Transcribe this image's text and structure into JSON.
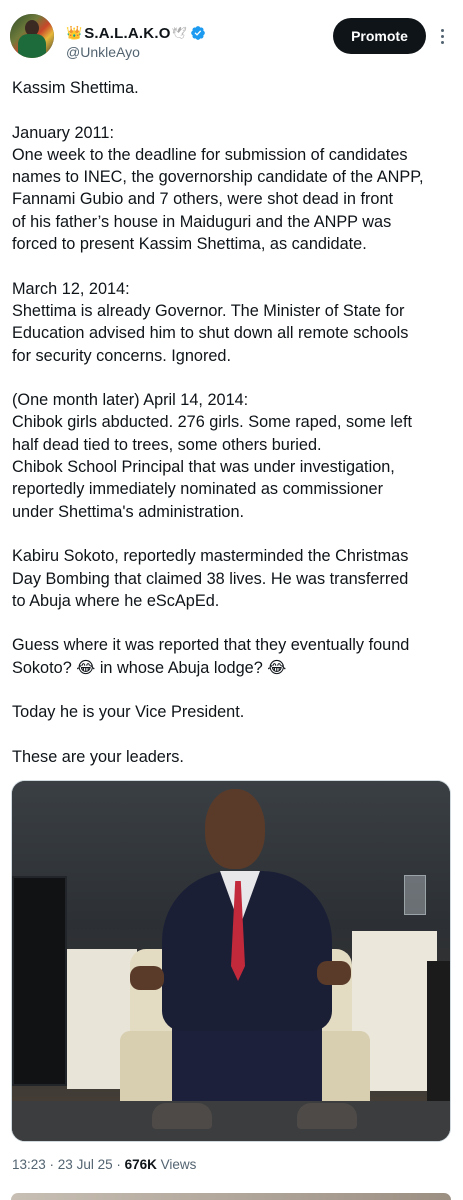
{
  "header": {
    "avatar_icon": "profile-avatar",
    "crown_icon": "👑",
    "display_name": "S.A.L.A.K.O",
    "dove_icon": "🕊",
    "verified_icon": "verified-badge-icon",
    "verified_color": "#1d9bf0",
    "handle": "@UnkleAyo",
    "promote_label": "Promote",
    "more_icon": "more-vertical-icon"
  },
  "tweet": {
    "p1": [
      "Kassim Shettima."
    ],
    "p2": [
      "January 2011:",
      "One week to the deadline for submission of candidates",
      "names to INEC, the governorship candidate of the ANPP,",
      "Fannami Gubio and 7 others, were shot dead in front",
      "of his father’s house in Maiduguri and the ANPP was",
      "forced to present Kassim Shettima, as candidate."
    ],
    "p3": [
      "March 12, 2014:",
      "Shettima is already Governor. The Minister of State for",
      "Education advised him to shut down all remote schools",
      "for security concerns. Ignored."
    ],
    "p4": [
      "(One month later) April 14, 2014:",
      "Chibok girls abducted. 276 girls. Some raped, some left",
      "half dead tied to trees, some others buried.",
      "Chibok School Principal that was under investigation,",
      "reportedly immediately nominated as commissioner",
      "under Shettima's administration."
    ],
    "p5": [
      "Kabiru Sokoto, reportedly masterminded the Christmas",
      "Day Bombing that claimed 38 lives. He was transferred",
      "to Abuja where he eScApEd."
    ],
    "p6": [
      "Guess where it was reported that they eventually found",
      "Sokoto? 😂 in whose Abuja lodge? 😂"
    ],
    "p7": [
      "Today he is your Vice President."
    ],
    "p8": [
      "These are your leaders."
    ]
  },
  "media": {
    "image_icon": "photo-man-seated-in-armchair"
  },
  "meta": {
    "time": "13:23",
    "sep1": " · ",
    "date": "23 Jul 25",
    "sep2": " · ",
    "views_count": "676K",
    "views_label": " Views"
  }
}
